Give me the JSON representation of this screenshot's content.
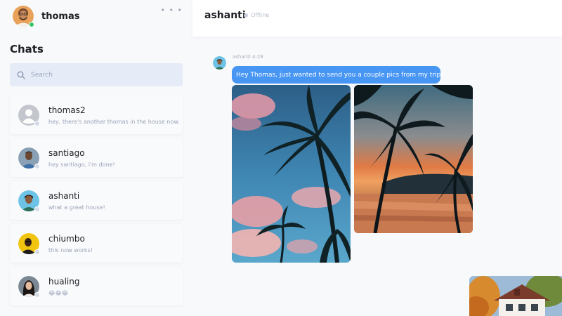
{
  "current_user": {
    "name": "thomas",
    "status_color": "#35c46b"
  },
  "sidebar": {
    "more_icon": "ellipsis-icon",
    "title": "Chats",
    "search": {
      "placeholder": "Search",
      "value": ""
    },
    "chats": [
      {
        "name": "thomas2",
        "preview": "hey, there's another thomas in the house now.",
        "avatar": "default-avatar"
      },
      {
        "name": "santiago",
        "preview": "hey santiago, i'm done!",
        "avatar": "photo-avatar"
      },
      {
        "name": "ashanti",
        "preview": "what a great house!",
        "avatar": "photo-avatar"
      },
      {
        "name": "chiumbo",
        "preview": "this now works!",
        "avatar": "photo-avatar"
      },
      {
        "name": "hualing",
        "preview": "😂😂😂",
        "avatar": "photo-avatar"
      }
    ]
  },
  "conversation": {
    "title": "ashanti",
    "status": "Offline",
    "message": {
      "meta": "ashanti 4:28",
      "text": "Hey Thomas, just wanted to send you a couple pics from my trip!",
      "bubble_color": "#4896f4"
    },
    "attachments": [
      "palm-trees-sky-photo",
      "palm-trees-sunset-photo"
    ]
  }
}
